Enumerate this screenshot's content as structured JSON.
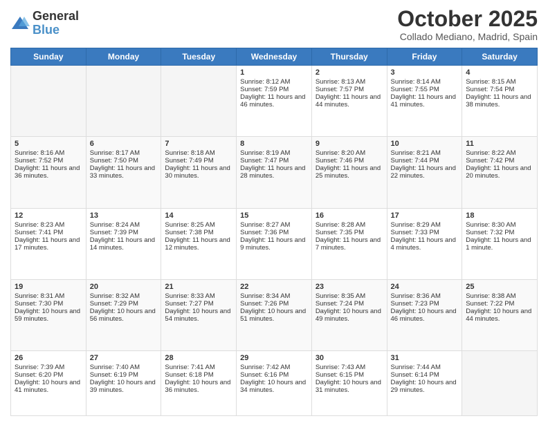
{
  "logo": {
    "general": "General",
    "blue": "Blue"
  },
  "header": {
    "month": "October 2025",
    "location": "Collado Mediano, Madrid, Spain"
  },
  "weekdays": [
    "Sunday",
    "Monday",
    "Tuesday",
    "Wednesday",
    "Thursday",
    "Friday",
    "Saturday"
  ],
  "weeks": [
    [
      {
        "day": "",
        "sunrise": "",
        "sunset": "",
        "daylight": ""
      },
      {
        "day": "",
        "sunrise": "",
        "sunset": "",
        "daylight": ""
      },
      {
        "day": "",
        "sunrise": "",
        "sunset": "",
        "daylight": ""
      },
      {
        "day": "1",
        "sunrise": "Sunrise: 8:12 AM",
        "sunset": "Sunset: 7:59 PM",
        "daylight": "Daylight: 11 hours and 46 minutes."
      },
      {
        "day": "2",
        "sunrise": "Sunrise: 8:13 AM",
        "sunset": "Sunset: 7:57 PM",
        "daylight": "Daylight: 11 hours and 44 minutes."
      },
      {
        "day": "3",
        "sunrise": "Sunrise: 8:14 AM",
        "sunset": "Sunset: 7:55 PM",
        "daylight": "Daylight: 11 hours and 41 minutes."
      },
      {
        "day": "4",
        "sunrise": "Sunrise: 8:15 AM",
        "sunset": "Sunset: 7:54 PM",
        "daylight": "Daylight: 11 hours and 38 minutes."
      }
    ],
    [
      {
        "day": "5",
        "sunrise": "Sunrise: 8:16 AM",
        "sunset": "Sunset: 7:52 PM",
        "daylight": "Daylight: 11 hours and 36 minutes."
      },
      {
        "day": "6",
        "sunrise": "Sunrise: 8:17 AM",
        "sunset": "Sunset: 7:50 PM",
        "daylight": "Daylight: 11 hours and 33 minutes."
      },
      {
        "day": "7",
        "sunrise": "Sunrise: 8:18 AM",
        "sunset": "Sunset: 7:49 PM",
        "daylight": "Daylight: 11 hours and 30 minutes."
      },
      {
        "day": "8",
        "sunrise": "Sunrise: 8:19 AM",
        "sunset": "Sunset: 7:47 PM",
        "daylight": "Daylight: 11 hours and 28 minutes."
      },
      {
        "day": "9",
        "sunrise": "Sunrise: 8:20 AM",
        "sunset": "Sunset: 7:46 PM",
        "daylight": "Daylight: 11 hours and 25 minutes."
      },
      {
        "day": "10",
        "sunrise": "Sunrise: 8:21 AM",
        "sunset": "Sunset: 7:44 PM",
        "daylight": "Daylight: 11 hours and 22 minutes."
      },
      {
        "day": "11",
        "sunrise": "Sunrise: 8:22 AM",
        "sunset": "Sunset: 7:42 PM",
        "daylight": "Daylight: 11 hours and 20 minutes."
      }
    ],
    [
      {
        "day": "12",
        "sunrise": "Sunrise: 8:23 AM",
        "sunset": "Sunset: 7:41 PM",
        "daylight": "Daylight: 11 hours and 17 minutes."
      },
      {
        "day": "13",
        "sunrise": "Sunrise: 8:24 AM",
        "sunset": "Sunset: 7:39 PM",
        "daylight": "Daylight: 11 hours and 14 minutes."
      },
      {
        "day": "14",
        "sunrise": "Sunrise: 8:25 AM",
        "sunset": "Sunset: 7:38 PM",
        "daylight": "Daylight: 11 hours and 12 minutes."
      },
      {
        "day": "15",
        "sunrise": "Sunrise: 8:27 AM",
        "sunset": "Sunset: 7:36 PM",
        "daylight": "Daylight: 11 hours and 9 minutes."
      },
      {
        "day": "16",
        "sunrise": "Sunrise: 8:28 AM",
        "sunset": "Sunset: 7:35 PM",
        "daylight": "Daylight: 11 hours and 7 minutes."
      },
      {
        "day": "17",
        "sunrise": "Sunrise: 8:29 AM",
        "sunset": "Sunset: 7:33 PM",
        "daylight": "Daylight: 11 hours and 4 minutes."
      },
      {
        "day": "18",
        "sunrise": "Sunrise: 8:30 AM",
        "sunset": "Sunset: 7:32 PM",
        "daylight": "Daylight: 11 hours and 1 minute."
      }
    ],
    [
      {
        "day": "19",
        "sunrise": "Sunrise: 8:31 AM",
        "sunset": "Sunset: 7:30 PM",
        "daylight": "Daylight: 10 hours and 59 minutes."
      },
      {
        "day": "20",
        "sunrise": "Sunrise: 8:32 AM",
        "sunset": "Sunset: 7:29 PM",
        "daylight": "Daylight: 10 hours and 56 minutes."
      },
      {
        "day": "21",
        "sunrise": "Sunrise: 8:33 AM",
        "sunset": "Sunset: 7:27 PM",
        "daylight": "Daylight: 10 hours and 54 minutes."
      },
      {
        "day": "22",
        "sunrise": "Sunrise: 8:34 AM",
        "sunset": "Sunset: 7:26 PM",
        "daylight": "Daylight: 10 hours and 51 minutes."
      },
      {
        "day": "23",
        "sunrise": "Sunrise: 8:35 AM",
        "sunset": "Sunset: 7:24 PM",
        "daylight": "Daylight: 10 hours and 49 minutes."
      },
      {
        "day": "24",
        "sunrise": "Sunrise: 8:36 AM",
        "sunset": "Sunset: 7:23 PM",
        "daylight": "Daylight: 10 hours and 46 minutes."
      },
      {
        "day": "25",
        "sunrise": "Sunrise: 8:38 AM",
        "sunset": "Sunset: 7:22 PM",
        "daylight": "Daylight: 10 hours and 44 minutes."
      }
    ],
    [
      {
        "day": "26",
        "sunrise": "Sunrise: 7:39 AM",
        "sunset": "Sunset: 6:20 PM",
        "daylight": "Daylight: 10 hours and 41 minutes."
      },
      {
        "day": "27",
        "sunrise": "Sunrise: 7:40 AM",
        "sunset": "Sunset: 6:19 PM",
        "daylight": "Daylight: 10 hours and 39 minutes."
      },
      {
        "day": "28",
        "sunrise": "Sunrise: 7:41 AM",
        "sunset": "Sunset: 6:18 PM",
        "daylight": "Daylight: 10 hours and 36 minutes."
      },
      {
        "day": "29",
        "sunrise": "Sunrise: 7:42 AM",
        "sunset": "Sunset: 6:16 PM",
        "daylight": "Daylight: 10 hours and 34 minutes."
      },
      {
        "day": "30",
        "sunrise": "Sunrise: 7:43 AM",
        "sunset": "Sunset: 6:15 PM",
        "daylight": "Daylight: 10 hours and 31 minutes."
      },
      {
        "day": "31",
        "sunrise": "Sunrise: 7:44 AM",
        "sunset": "Sunset: 6:14 PM",
        "daylight": "Daylight: 10 hours and 29 minutes."
      },
      {
        "day": "",
        "sunrise": "",
        "sunset": "",
        "daylight": ""
      }
    ]
  ]
}
